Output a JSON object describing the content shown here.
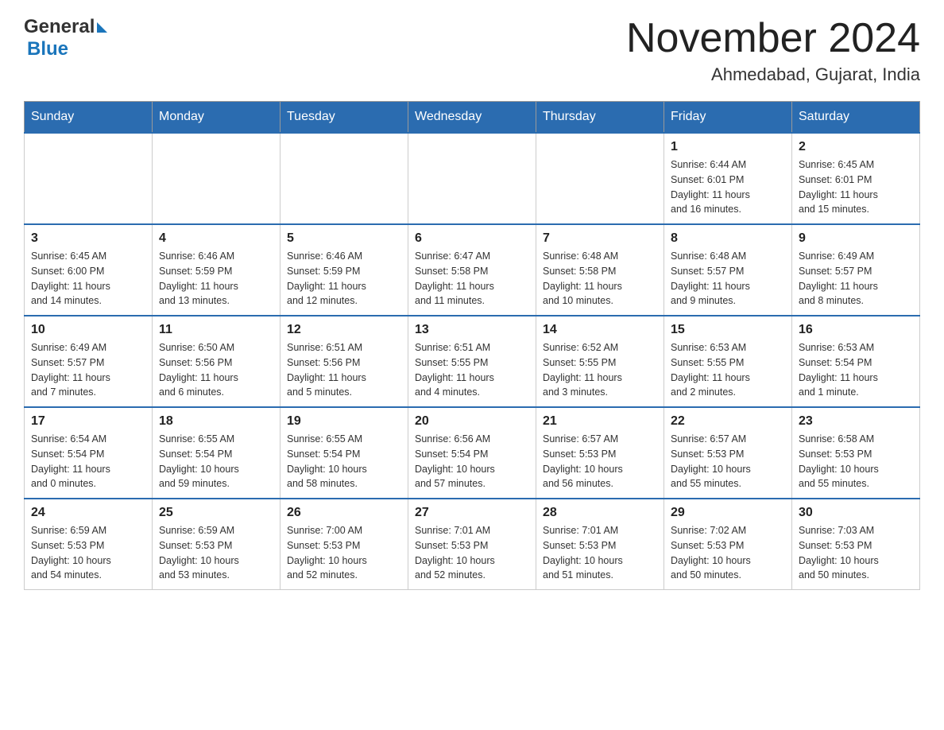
{
  "header": {
    "logo_general": "General",
    "logo_blue": "Blue",
    "month_title": "November 2024",
    "location": "Ahmedabad, Gujarat, India"
  },
  "days_of_week": [
    "Sunday",
    "Monday",
    "Tuesday",
    "Wednesday",
    "Thursday",
    "Friday",
    "Saturday"
  ],
  "weeks": [
    {
      "cells": [
        {
          "day": "",
          "info": ""
        },
        {
          "day": "",
          "info": ""
        },
        {
          "day": "",
          "info": ""
        },
        {
          "day": "",
          "info": ""
        },
        {
          "day": "",
          "info": ""
        },
        {
          "day": "1",
          "info": "Sunrise: 6:44 AM\nSunset: 6:01 PM\nDaylight: 11 hours\nand 16 minutes."
        },
        {
          "day": "2",
          "info": "Sunrise: 6:45 AM\nSunset: 6:01 PM\nDaylight: 11 hours\nand 15 minutes."
        }
      ]
    },
    {
      "cells": [
        {
          "day": "3",
          "info": "Sunrise: 6:45 AM\nSunset: 6:00 PM\nDaylight: 11 hours\nand 14 minutes."
        },
        {
          "day": "4",
          "info": "Sunrise: 6:46 AM\nSunset: 5:59 PM\nDaylight: 11 hours\nand 13 minutes."
        },
        {
          "day": "5",
          "info": "Sunrise: 6:46 AM\nSunset: 5:59 PM\nDaylight: 11 hours\nand 12 minutes."
        },
        {
          "day": "6",
          "info": "Sunrise: 6:47 AM\nSunset: 5:58 PM\nDaylight: 11 hours\nand 11 minutes."
        },
        {
          "day": "7",
          "info": "Sunrise: 6:48 AM\nSunset: 5:58 PM\nDaylight: 11 hours\nand 10 minutes."
        },
        {
          "day": "8",
          "info": "Sunrise: 6:48 AM\nSunset: 5:57 PM\nDaylight: 11 hours\nand 9 minutes."
        },
        {
          "day": "9",
          "info": "Sunrise: 6:49 AM\nSunset: 5:57 PM\nDaylight: 11 hours\nand 8 minutes."
        }
      ]
    },
    {
      "cells": [
        {
          "day": "10",
          "info": "Sunrise: 6:49 AM\nSunset: 5:57 PM\nDaylight: 11 hours\nand 7 minutes."
        },
        {
          "day": "11",
          "info": "Sunrise: 6:50 AM\nSunset: 5:56 PM\nDaylight: 11 hours\nand 6 minutes."
        },
        {
          "day": "12",
          "info": "Sunrise: 6:51 AM\nSunset: 5:56 PM\nDaylight: 11 hours\nand 5 minutes."
        },
        {
          "day": "13",
          "info": "Sunrise: 6:51 AM\nSunset: 5:55 PM\nDaylight: 11 hours\nand 4 minutes."
        },
        {
          "day": "14",
          "info": "Sunrise: 6:52 AM\nSunset: 5:55 PM\nDaylight: 11 hours\nand 3 minutes."
        },
        {
          "day": "15",
          "info": "Sunrise: 6:53 AM\nSunset: 5:55 PM\nDaylight: 11 hours\nand 2 minutes."
        },
        {
          "day": "16",
          "info": "Sunrise: 6:53 AM\nSunset: 5:54 PM\nDaylight: 11 hours\nand 1 minute."
        }
      ]
    },
    {
      "cells": [
        {
          "day": "17",
          "info": "Sunrise: 6:54 AM\nSunset: 5:54 PM\nDaylight: 11 hours\nand 0 minutes."
        },
        {
          "day": "18",
          "info": "Sunrise: 6:55 AM\nSunset: 5:54 PM\nDaylight: 10 hours\nand 59 minutes."
        },
        {
          "day": "19",
          "info": "Sunrise: 6:55 AM\nSunset: 5:54 PM\nDaylight: 10 hours\nand 58 minutes."
        },
        {
          "day": "20",
          "info": "Sunrise: 6:56 AM\nSunset: 5:54 PM\nDaylight: 10 hours\nand 57 minutes."
        },
        {
          "day": "21",
          "info": "Sunrise: 6:57 AM\nSunset: 5:53 PM\nDaylight: 10 hours\nand 56 minutes."
        },
        {
          "day": "22",
          "info": "Sunrise: 6:57 AM\nSunset: 5:53 PM\nDaylight: 10 hours\nand 55 minutes."
        },
        {
          "day": "23",
          "info": "Sunrise: 6:58 AM\nSunset: 5:53 PM\nDaylight: 10 hours\nand 55 minutes."
        }
      ]
    },
    {
      "cells": [
        {
          "day": "24",
          "info": "Sunrise: 6:59 AM\nSunset: 5:53 PM\nDaylight: 10 hours\nand 54 minutes."
        },
        {
          "day": "25",
          "info": "Sunrise: 6:59 AM\nSunset: 5:53 PM\nDaylight: 10 hours\nand 53 minutes."
        },
        {
          "day": "26",
          "info": "Sunrise: 7:00 AM\nSunset: 5:53 PM\nDaylight: 10 hours\nand 52 minutes."
        },
        {
          "day": "27",
          "info": "Sunrise: 7:01 AM\nSunset: 5:53 PM\nDaylight: 10 hours\nand 52 minutes."
        },
        {
          "day": "28",
          "info": "Sunrise: 7:01 AM\nSunset: 5:53 PM\nDaylight: 10 hours\nand 51 minutes."
        },
        {
          "day": "29",
          "info": "Sunrise: 7:02 AM\nSunset: 5:53 PM\nDaylight: 10 hours\nand 50 minutes."
        },
        {
          "day": "30",
          "info": "Sunrise: 7:03 AM\nSunset: 5:53 PM\nDaylight: 10 hours\nand 50 minutes."
        }
      ]
    }
  ]
}
